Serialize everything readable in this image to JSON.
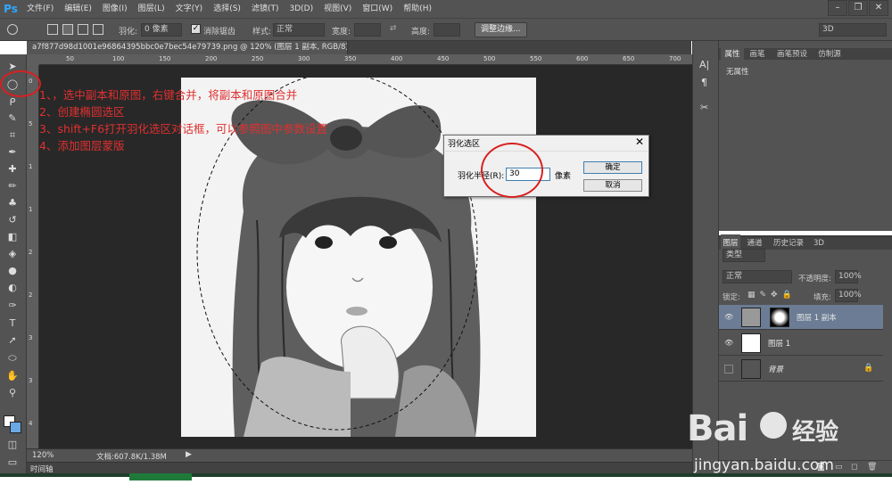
{
  "app": {
    "logo": "Ps",
    "menus": [
      "文件(F)",
      "编辑(E)",
      "图像(I)",
      "图层(L)",
      "文字(Y)",
      "选择(S)",
      "滤镜(T)",
      "3D(D)",
      "视图(V)",
      "窗口(W)",
      "帮助(H)"
    ],
    "window_controls": [
      "–",
      "❐",
      "✕"
    ]
  },
  "options": {
    "feather_label": "羽化:",
    "feather_value": "0 像素",
    "antialias_label": "消除锯齿",
    "style_label": "样式:",
    "style_value": "正常",
    "width_label": "宽度:",
    "height_label": "高度:",
    "refine_button": "调整边缘...",
    "workspace_value": "3D"
  },
  "document": {
    "tab_title": "a7f877d98d1001e96864395bbc0e7bec54e79739.png @ 120% (图层 1 副本, RGB/8) *",
    "tab_close": "×",
    "zoom": "120%",
    "doc_info": "文档:607.8K/1.38M",
    "timeline": "时间轴"
  },
  "rulers": {
    "top": [
      "50",
      "100",
      "150",
      "200",
      "250",
      "300",
      "350",
      "400",
      "450",
      "500",
      "550",
      "600",
      "650",
      "700"
    ],
    "left": [
      "0",
      "5",
      "1",
      "1",
      "2",
      "2",
      "3",
      "3",
      "4"
    ]
  },
  "annotation": {
    "line1": "1、，选中副本和原图，右键合并，将副本和原图合并",
    "line2": "2、创建椭圆选区",
    "line3": "3、shift+F6打开羽化选区对话框，可以参照图中参数设置",
    "line4": "4、添加图层蒙版"
  },
  "dialog": {
    "title": "羽化选区",
    "radius_label": "羽化半径(R):",
    "radius_value": "30",
    "unit": "像素",
    "ok": "确定",
    "cancel": "取消",
    "close": "✕"
  },
  "properties_panel": {
    "tabs": [
      "属性",
      "画笔",
      "画笔预设",
      "仿制源"
    ],
    "content": "无属性"
  },
  "layers_panel": {
    "tabs": [
      "图层",
      "通道",
      "历史记录",
      "3D"
    ],
    "filter_label": "类型",
    "blend_mode": "正常",
    "opacity_label": "不透明度:",
    "opacity_value": "100%",
    "lock_label": "锁定:",
    "fill_label": "填充:",
    "fill_value": "100%",
    "layers": [
      {
        "name": "图层 1 副本",
        "selected": true
      },
      {
        "name": "图层 1",
        "selected": false
      },
      {
        "name": "背景",
        "selected": false
      }
    ]
  },
  "watermark": {
    "brand": "Bai",
    "brand_suffix": "经验",
    "url": "jingyan.baidu.com"
  },
  "colors": {
    "ui_bg": "#535353",
    "canvas_bg": "#282828",
    "annotation": "#e03030",
    "accent_blue": "#31a8ff"
  }
}
